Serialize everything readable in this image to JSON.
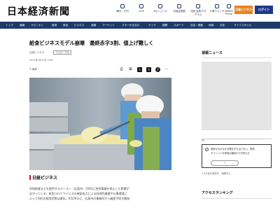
{
  "header": {
    "logo": "日本経済新聞",
    "icons": [
      {
        "label": "朝刊・夕刊",
        "icon": "newspaper-icon"
      },
      {
        "label": "LIVE",
        "icon": "live-icon"
      },
      {
        "label": "Myニュース",
        "icon": "star-icon"
      },
      {
        "label": "日経会員割",
        "icon": "coupon-icon"
      },
      {
        "label": "日経 会員プログラム",
        "icon": "program-icon"
      },
      {
        "label": "人事ウォッチ",
        "icon": "people-icon"
      },
      {
        "label": "NIKKEI Prime",
        "icon": "prime-icon"
      }
    ],
    "business_button": "日経ビジネス",
    "login_button": "ログイン"
  },
  "nav": [
    "トップ",
    "速報",
    "オピニオン",
    "経済",
    "政治",
    "ビジネス",
    "金融",
    "マーケット",
    "マネーのまなび",
    "テック",
    "国際",
    "スポーツ",
    "社会・調査",
    "地域",
    "文化",
    "ライフスタイル"
  ],
  "article": {
    "headline": "給食ビジネスモデル崩壊　最終赤字3割、値上げ難しく",
    "source": "日経ビジネス",
    "tag": "フォローする",
    "date": "2025年3月17日 5:00",
    "save_label": "保存",
    "share_icons": [
      "print-icon",
      "copy-icon",
      "x-icon",
      "x-icon",
      "facebook-icon",
      "share-icon"
    ],
    "brand": "日経ビジネス",
    "body_lines": [
      "学校給食などを提供するホーユー（広島市）が9月に突然事業を停止した影響が",
      "広がっている。新型コロナウイルスの感染拡大による料理作業量や仕事環境に",
      "よって同社の経営状態は悪化。9月29日に、広島市の事務所から破産手続き開始"
    ]
  },
  "sidebar": {
    "news_title": "速報ニュース",
    "pr_label": "PR",
    "promo_lines": [
      "政府がなかなか対策を打ち出さない。事態",
      "チャレンジを特別広報窓口でお知らせ"
    ],
    "note": "1,3万会を政府を、指摘中だ",
    "ranking_title": "アクセスランキング"
  },
  "colors": {
    "nav_bg": "#1e3a6a",
    "business_button": "#e8821e",
    "login_button": "#1e3a8a",
    "brand_accent": "#c9162b"
  }
}
